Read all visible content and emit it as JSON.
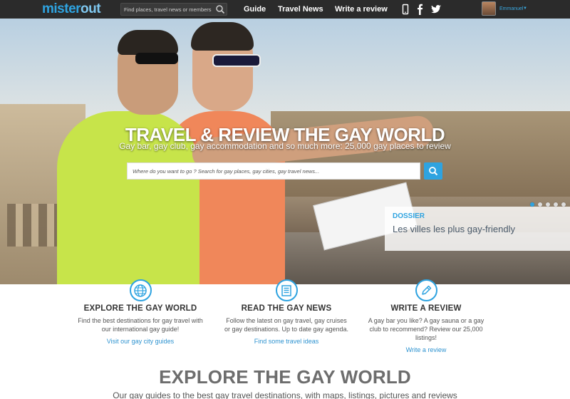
{
  "header": {
    "logo_part1": "mister",
    "logo_part2": "out",
    "search_placeholder": "Find places, travel news or members",
    "nav": [
      "Guide",
      "Travel News",
      "Write a review"
    ],
    "user_name": "Emmanuel",
    "user_caret": "▼"
  },
  "hero": {
    "title": "TRAVEL & REVIEW THE GAY WORLD",
    "subtitle": "Gay bar, gay club, gay accommodation and so much more: 25,000 gay places to review",
    "search_placeholder": "Where do you want to go ? Search for gay places, gay cities, gay travel news...",
    "dossier_tag": "DOSSIER",
    "dossier_title": "Les villes les plus gay-friendly",
    "slides_count": 5,
    "active_slide": 1
  },
  "features": [
    {
      "icon": "globe-icon",
      "title": "EXPLORE THE GAY WORLD",
      "text": "Find the best destinations for gay travel with our international gay guide!",
      "link": "Visit our gay city guides"
    },
    {
      "icon": "news-icon",
      "title": "READ THE GAY NEWS",
      "text": "Follow the latest on gay travel, gay cruises or gay destinations. Up to date gay agenda.",
      "link": "Find some travel ideas"
    },
    {
      "icon": "pencil-icon",
      "title": "WRITE A REVIEW",
      "text": "A gay bar you like? A gay sauna or a gay club to recommend? Review our 25,000 listings!",
      "link": "Write a review"
    }
  ],
  "section": {
    "title": "EXPLORE THE GAY WORLD",
    "subtitle": "Our gay guides to the best gay travel destinations, with maps, listings, pictures and reviews"
  },
  "colors": {
    "accent": "#2ea3e0",
    "topbar": "#2b2b2b"
  }
}
